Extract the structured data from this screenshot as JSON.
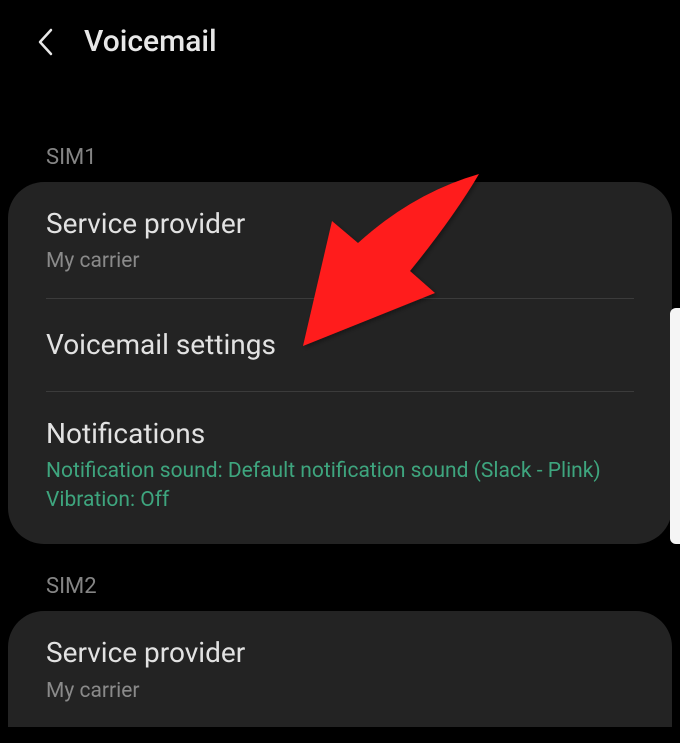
{
  "header": {
    "title": "Voicemail"
  },
  "sections": [
    {
      "label": "SIM1",
      "items": [
        {
          "title": "Service provider",
          "subtitle": "My carrier"
        },
        {
          "title": "Voicemail settings"
        },
        {
          "title": "Notifications",
          "subtitle_line1": "Notification sound: Default notification sound (Slack - Plink)",
          "subtitle_line2": "Vibration: Off"
        }
      ]
    },
    {
      "label": "SIM2",
      "items": [
        {
          "title": "Service provider",
          "subtitle": "My carrier"
        }
      ]
    }
  ]
}
